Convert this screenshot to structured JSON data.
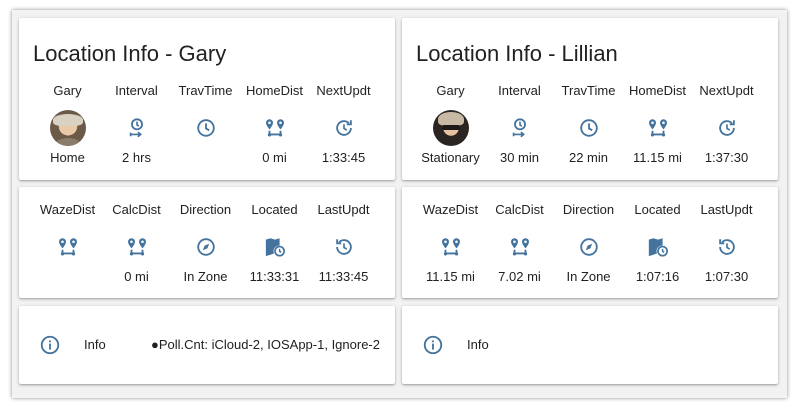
{
  "accent_color": "#44739e",
  "cards": {
    "gary": {
      "title": "Location Info - Gary",
      "top_row": [
        {
          "name": "Gary",
          "icon": "avatar-gary",
          "value": "Home"
        },
        {
          "name": "Interval",
          "icon": "timer-interval-icon",
          "value": "2 hrs"
        },
        {
          "name": "TravTime",
          "icon": "clock-icon",
          "value": ""
        },
        {
          "name": "HomeDist",
          "icon": "map-marker-distance-icon",
          "value": "0 mi"
        },
        {
          "name": "NextUpdt",
          "icon": "refresh-clock-icon",
          "value": "1:33:45"
        }
      ],
      "mid_row": [
        {
          "name": "WazeDist",
          "icon": "map-marker-distance-icon",
          "value": ""
        },
        {
          "name": "CalcDist",
          "icon": "map-marker-distance-icon",
          "value": "0 mi"
        },
        {
          "name": "Direction",
          "icon": "compass-icon",
          "value": "In Zone"
        },
        {
          "name": "Located",
          "icon": "map-clock-icon",
          "value": "11:33:31"
        },
        {
          "name": "LastUpdt",
          "icon": "history-icon",
          "value": "11:33:45"
        }
      ],
      "info": {
        "label": "Info",
        "text": "●Poll.Cnt: iCloud-2, IOSApp-1, Ignore-2"
      }
    },
    "lillian": {
      "title": "Location Info - Lillian",
      "top_row": [
        {
          "name": "Gary",
          "icon": "avatar-lillian",
          "value": "Stationary"
        },
        {
          "name": "Interval",
          "icon": "timer-interval-icon",
          "value": "30 min"
        },
        {
          "name": "TravTime",
          "icon": "clock-icon",
          "value": "22 min"
        },
        {
          "name": "HomeDist",
          "icon": "map-marker-distance-icon",
          "value": "11.15 mi"
        },
        {
          "name": "NextUpdt",
          "icon": "refresh-clock-icon",
          "value": "1:37:30"
        }
      ],
      "mid_row": [
        {
          "name": "WazeDist",
          "icon": "map-marker-distance-icon",
          "value": "11.15 mi"
        },
        {
          "name": "CalcDist",
          "icon": "map-marker-distance-icon",
          "value": "7.02 mi"
        },
        {
          "name": "Direction",
          "icon": "compass-icon",
          "value": "In Zone"
        },
        {
          "name": "Located",
          "icon": "map-clock-icon",
          "value": "1:07:16"
        },
        {
          "name": "LastUpdt",
          "icon": "history-icon",
          "value": "1:07:30"
        }
      ],
      "info": {
        "label": "Info",
        "text": ""
      }
    }
  }
}
